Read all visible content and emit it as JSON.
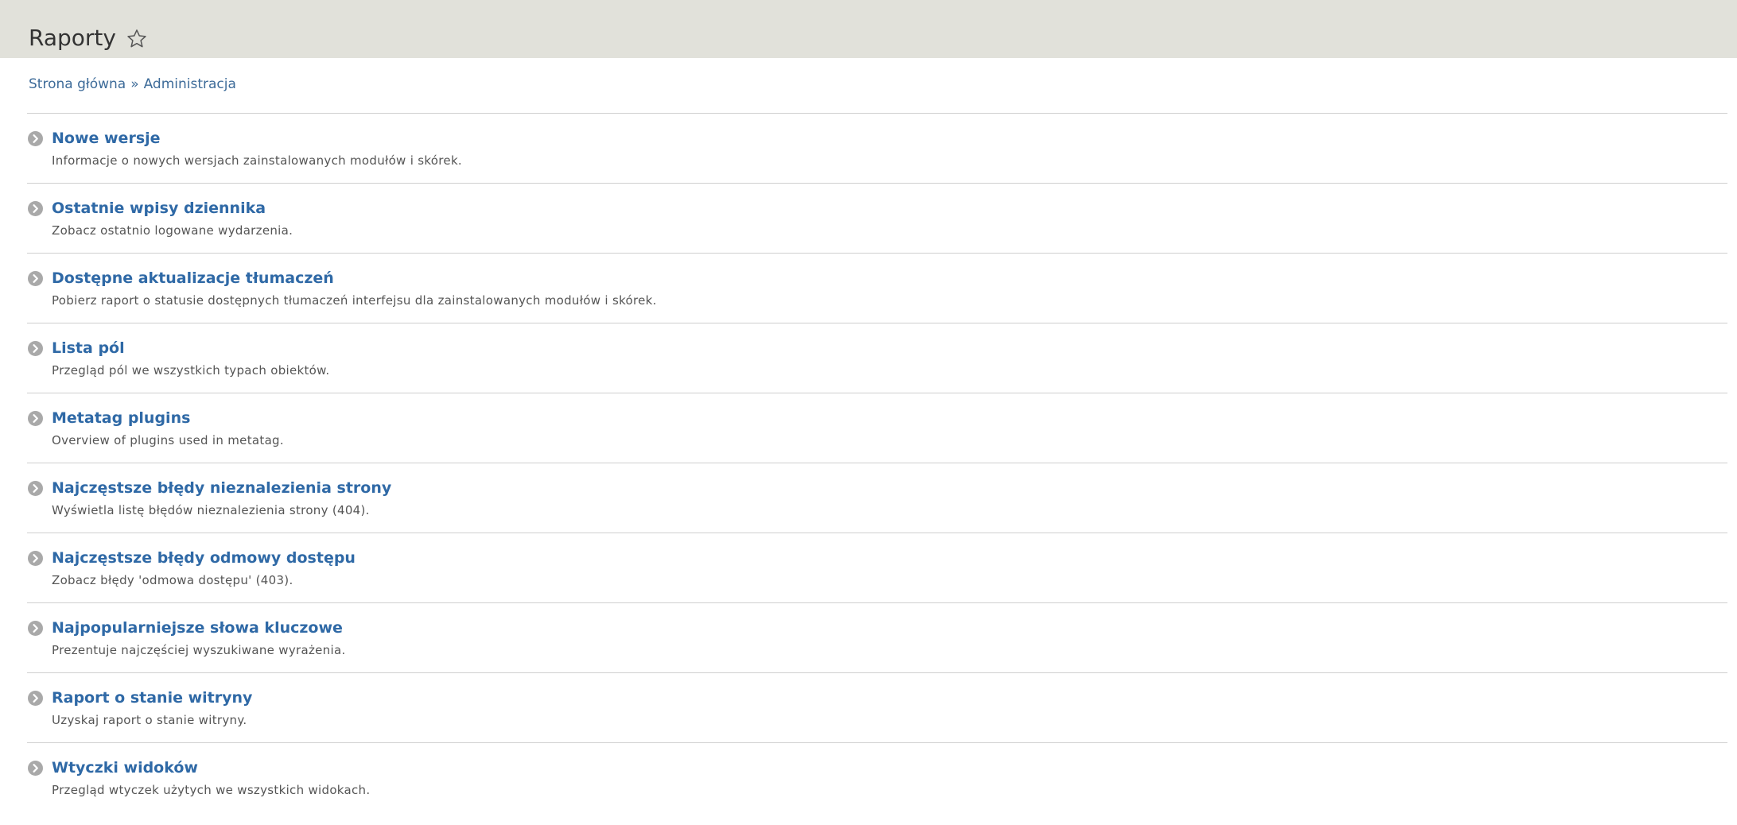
{
  "header": {
    "title": "Raporty"
  },
  "breadcrumb": {
    "home": "Strona główna",
    "separator": "»",
    "admin": "Administracja"
  },
  "items": [
    {
      "title": "Nowe wersje",
      "description": "Informacje o nowych wersjach zainstalowanych modułów i skórek."
    },
    {
      "title": "Ostatnie wpisy dziennika",
      "description": "Zobacz ostatnio logowane wydarzenia."
    },
    {
      "title": "Dostępne aktualizacje tłumaczeń",
      "description": "Pobierz raport o statusie dostępnych tłumaczeń interfejsu dla zainstalowanych modułów i skórek."
    },
    {
      "title": "Lista pól",
      "description": "Przegląd pól we wszystkich typach obiektów."
    },
    {
      "title": "Metatag plugins",
      "description": "Overview of plugins used in metatag."
    },
    {
      "title": "Najczęstsze błędy nieznalezienia strony",
      "description": "Wyświetla listę błędów nieznalezienia strony (404)."
    },
    {
      "title": "Najczęstsze błędy odmowy dostępu",
      "description": "Zobacz błędy 'odmowa dostępu' (403)."
    },
    {
      "title": "Najpopularniejsze słowa kluczowe",
      "description": "Prezentuje najczęściej wyszukiwane wyrażenia."
    },
    {
      "title": "Raport o stanie witryny",
      "description": "Uzyskaj raport o stanie witryny."
    },
    {
      "title": "Wtyczki widoków",
      "description": "Przegląd wtyczek użytych we wszystkich widokach."
    }
  ],
  "icons": {
    "favorite": "star-outline-icon",
    "item": "chevron-right-circle-icon"
  },
  "colors": {
    "header_bg": "#e1e1da",
    "link": "#2f69a6",
    "breadcrumb": "#3d6b99",
    "text": "#555555",
    "icon": "#a9a9a9",
    "divider": "#cfcfcf"
  }
}
